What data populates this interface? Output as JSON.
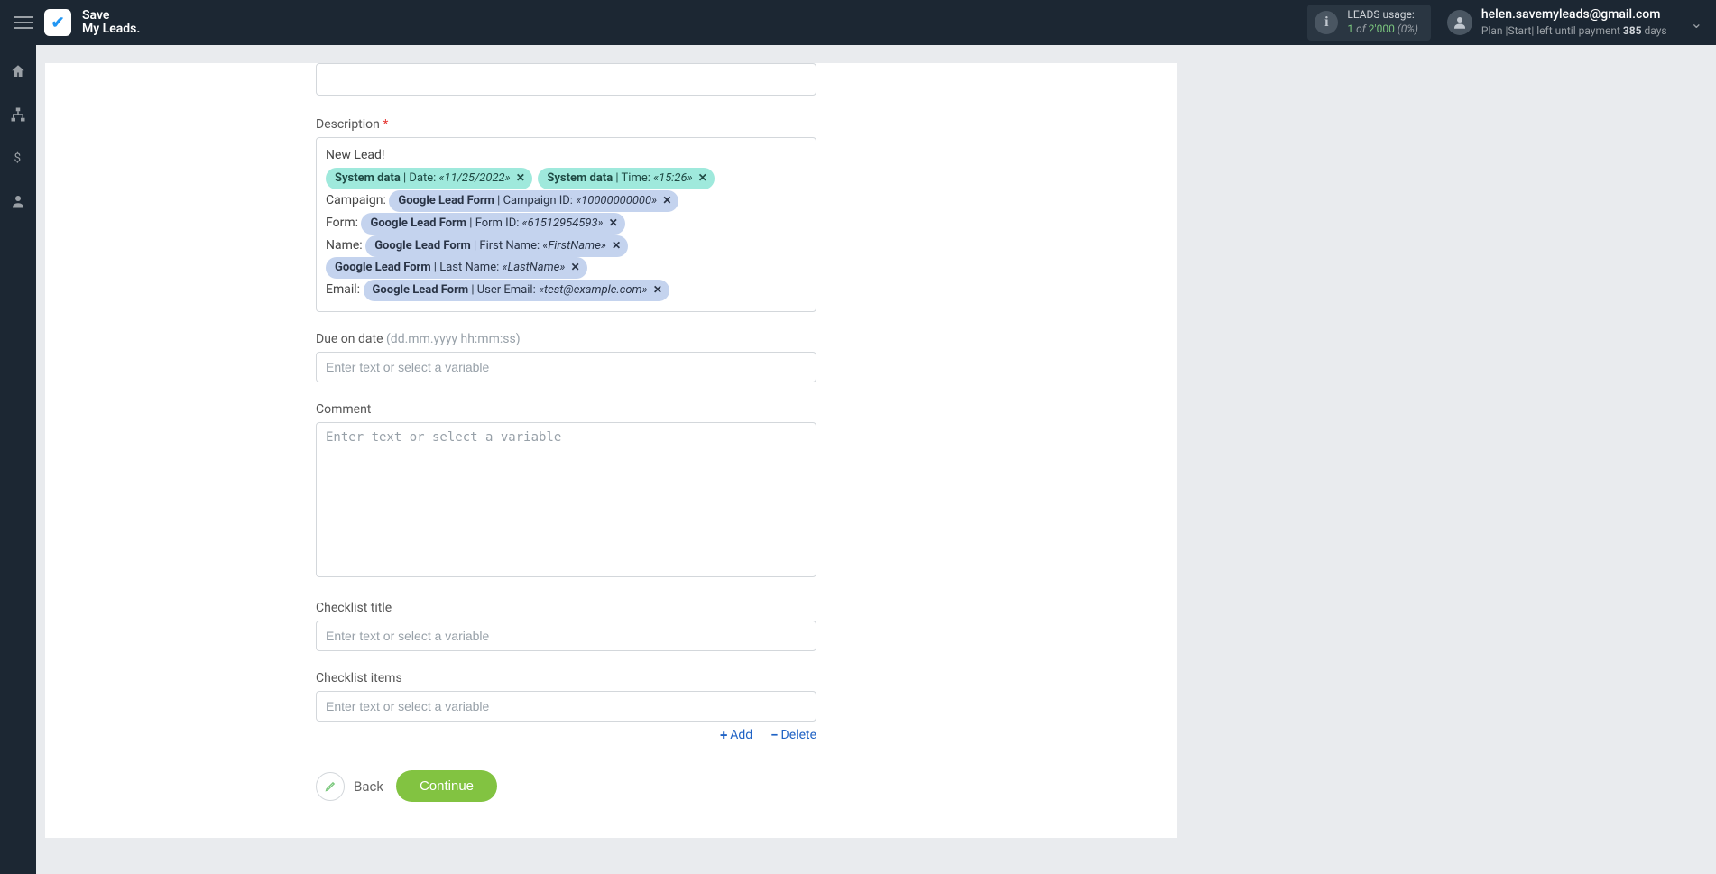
{
  "header": {
    "logo_line1": "Save",
    "logo_line2": "My Leads.",
    "usage_label": "LEADS usage:",
    "usage_current": "1",
    "usage_of": "of",
    "usage_total": "2'000",
    "usage_pct": "(0%)",
    "user_email": "helen.savemyleads@gmail.com",
    "plan_label": "Plan",
    "plan_name": "Start",
    "payment_prefix": "left until payment",
    "payment_days": "385",
    "payment_suffix": "days"
  },
  "form": {
    "description_label": "Description",
    "new_lead": "New Lead!",
    "tags": {
      "date_src": "System data",
      "date_lbl": "Date:",
      "date_val": "«11/25/2022»",
      "time_src": "System data",
      "time_lbl": "Time:",
      "time_val": "«15:26»",
      "campaign_prefix": "Campaign:",
      "campaign_src": "Google Lead Form",
      "campaign_lbl": "Campaign ID:",
      "campaign_val": "«10000000000»",
      "form_prefix": "Form:",
      "form_src": "Google Lead Form",
      "form_lbl": "Form ID:",
      "form_val": "«61512954593»",
      "name_prefix": "Name:",
      "fname_src": "Google Lead Form",
      "fname_lbl": "First Name:",
      "fname_val": "«FirstName»",
      "lname_src": "Google Lead Form",
      "lname_lbl": "Last Name:",
      "lname_val": "«LastName»",
      "email_prefix": "Email:",
      "email_src": "Google Lead Form",
      "email_lbl": "User Email:",
      "email_val": "«test@example.com»"
    },
    "due_label": "Due on date",
    "due_hint": "(dd.mm.yyyy hh:mm:ss)",
    "placeholder": "Enter text or select a variable",
    "comment_label": "Comment",
    "checklist_title_label": "Checklist title",
    "checklist_items_label": "Checklist items",
    "add_label": "Add",
    "delete_label": "Delete",
    "back_label": "Back",
    "continue_label": "Continue"
  }
}
